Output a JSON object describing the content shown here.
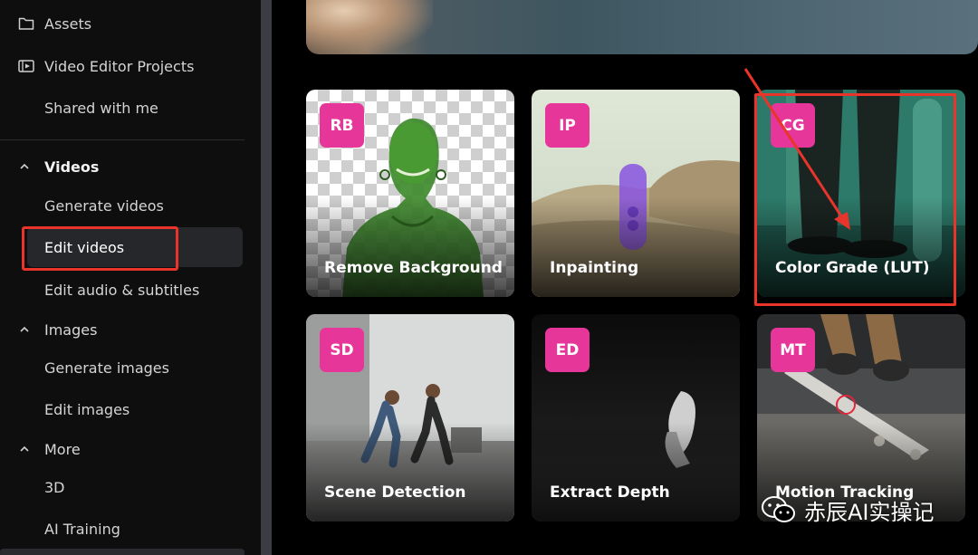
{
  "sidebar": {
    "top_items": [
      {
        "label": "Assets",
        "icon": "folder-icon"
      },
      {
        "label": "Video Editor Projects",
        "icon": "video-editor-icon"
      },
      {
        "label": "Shared with me",
        "icon": ""
      }
    ],
    "sections": {
      "videos": {
        "label": "Videos",
        "items": [
          "Generate videos",
          "Edit videos",
          "Edit audio & subtitles"
        ]
      },
      "images": {
        "label": "Images",
        "items": [
          "Generate images",
          "Edit images"
        ]
      },
      "more": {
        "label": "More",
        "items": [
          "3D",
          "AI Training"
        ]
      }
    },
    "selected_item": "Edit videos"
  },
  "cards": [
    {
      "badge": "RB",
      "title": "Remove Background"
    },
    {
      "badge": "IP",
      "title": "Inpainting"
    },
    {
      "badge": "CG",
      "title": "Color Grade (LUT)"
    },
    {
      "badge": "SD",
      "title": "Scene Detection"
    },
    {
      "badge": "ED",
      "title": "Extract Depth"
    },
    {
      "badge": "MT",
      "title": "Motion Tracking"
    }
  ],
  "watermark": {
    "text": "赤辰AI实操记",
    "icon": "wechat-icon"
  },
  "colors": {
    "badge": "#e6369a",
    "highlight": "#e8342a",
    "sidebar_bg": "#0e0e0f",
    "selected_bg": "#26272b"
  }
}
